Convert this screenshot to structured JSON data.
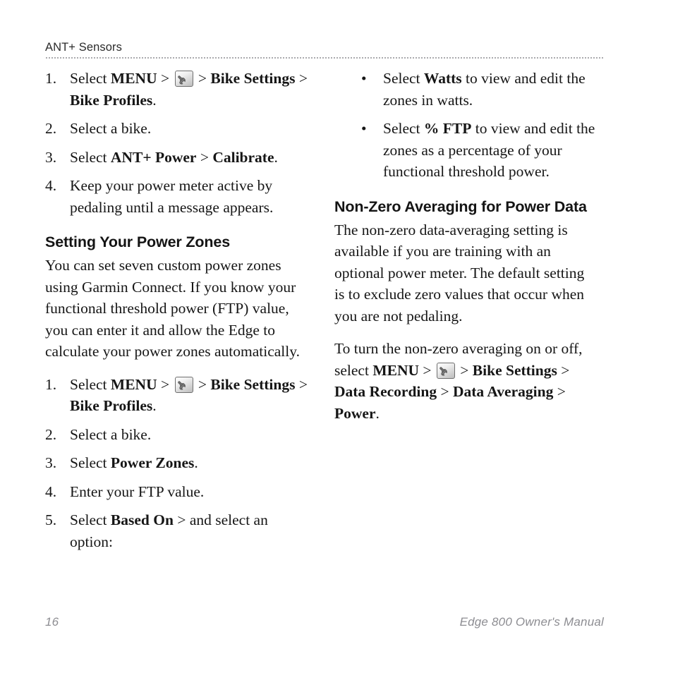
{
  "page": {
    "running_header": "ANT+ Sensors",
    "page_number": "16",
    "manual_title": "Edge 800 Owner's Manual"
  },
  "icons": {
    "wrench": "wrench-key-icon"
  },
  "left_column": {
    "calibrate_steps": [
      {
        "marker": "1.",
        "parts": [
          {
            "t": "Select ",
            "b": false
          },
          {
            "t": "MENU",
            "b": true
          },
          {
            "t": " > ",
            "b": false
          },
          {
            "t": "",
            "icon": "wrench"
          },
          {
            "t": " > ",
            "b": false
          },
          {
            "t": "Bike Settings",
            "b": true
          },
          {
            "t": " > ",
            "b": false
          },
          {
            "t": "Bike Profiles",
            "b": true
          },
          {
            "t": ".",
            "b": false
          }
        ]
      },
      {
        "marker": "2.",
        "parts": [
          {
            "t": "Select a bike.",
            "b": false
          }
        ]
      },
      {
        "marker": "3.",
        "parts": [
          {
            "t": "Select ",
            "b": false
          },
          {
            "t": "ANT+ Power",
            "b": true
          },
          {
            "t": " > ",
            "b": false
          },
          {
            "t": "Calibrate",
            "b": true
          },
          {
            "t": ".",
            "b": false
          }
        ]
      },
      {
        "marker": "4.",
        "parts": [
          {
            "t": "Keep your power meter active by pedaling until a message appears.",
            "b": false
          }
        ]
      }
    ],
    "power_zones_heading": "Setting Your Power Zones",
    "power_zones_intro": "You can set seven custom power zones using Garmin Connect. If you know your functional threshold power (FTP) value, you can enter it and allow the Edge to calculate your power zones automatically.",
    "power_zones_steps": [
      {
        "marker": "1.",
        "parts": [
          {
            "t": "Select ",
            "b": false
          },
          {
            "t": "MENU",
            "b": true
          },
          {
            "t": " > ",
            "b": false
          },
          {
            "t": "",
            "icon": "wrench"
          },
          {
            "t": " > ",
            "b": false
          },
          {
            "t": "Bike Settings",
            "b": true
          },
          {
            "t": " > ",
            "b": false
          },
          {
            "t": "Bike Profiles",
            "b": true
          },
          {
            "t": ".",
            "b": false
          }
        ]
      },
      {
        "marker": "2.",
        "parts": [
          {
            "t": "Select a bike.",
            "b": false
          }
        ]
      },
      {
        "marker": "3.",
        "parts": [
          {
            "t": "Select ",
            "b": false
          },
          {
            "t": "Power Zones",
            "b": true
          },
          {
            "t": ".",
            "b": false
          }
        ]
      },
      {
        "marker": "4.",
        "parts": [
          {
            "t": "Enter your FTP value.",
            "b": false
          }
        ]
      },
      {
        "marker": "5.",
        "parts": [
          {
            "t": "Select ",
            "b": false
          },
          {
            "t": "Based On",
            "b": true
          },
          {
            "t": " > and select an option:",
            "b": false
          }
        ]
      }
    ]
  },
  "right_column": {
    "option_bullets": [
      {
        "marker": "•",
        "parts": [
          {
            "t": "Select ",
            "b": false
          },
          {
            "t": "Watts",
            "b": true
          },
          {
            "t": " to view and edit the zones in watts.",
            "b": false
          }
        ]
      },
      {
        "marker": "•",
        "parts": [
          {
            "t": "Select ",
            "b": false
          },
          {
            "t": "% FTP",
            "b": true
          },
          {
            "t": " to view and edit the zones as a percentage of your functional threshold power.",
            "b": false
          }
        ]
      }
    ],
    "non_zero_heading": "Non-Zero Averaging for Power Data",
    "non_zero_para_1": "The non-zero data-averaging setting is available if you are training with an optional power meter. The default setting is to exclude zero values that occur when you are not pedaling.",
    "non_zero_para_2_parts": [
      {
        "t": "To turn the non-zero averaging on or off, select ",
        "b": false
      },
      {
        "t": "MENU",
        "b": true
      },
      {
        "t": " > ",
        "b": false
      },
      {
        "t": "",
        "icon": "wrench"
      },
      {
        "t": " > ",
        "b": false
      },
      {
        "t": "Bike Settings",
        "b": true
      },
      {
        "t": " > ",
        "b": false
      },
      {
        "t": "Data Recording",
        "b": true
      },
      {
        "t": " > ",
        "b": false
      },
      {
        "t": "Data Averaging",
        "b": true
      },
      {
        "t": " > ",
        "b": false
      },
      {
        "t": "Power",
        "b": true
      },
      {
        "t": ".",
        "b": false
      }
    ]
  },
  "colors": {
    "text": "#161616",
    "heading": "#141414",
    "running_header": "#2b2b2b",
    "footer": "#8d8d92",
    "rule_dots": "#8e8e92"
  }
}
